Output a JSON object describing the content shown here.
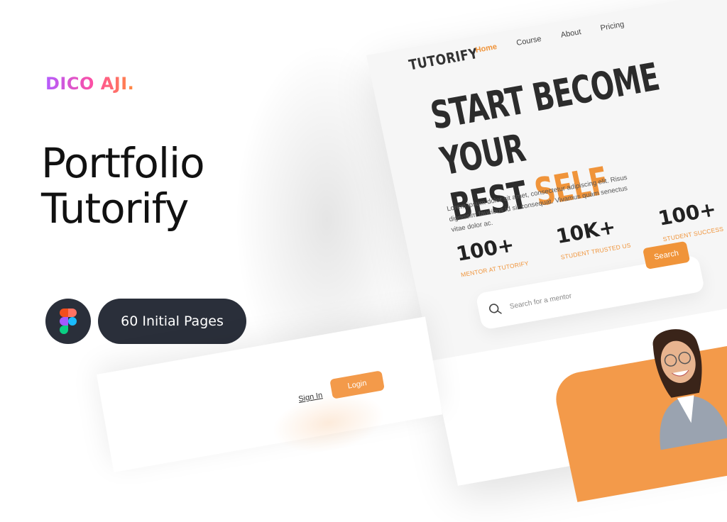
{
  "brand": "DICO AJI.",
  "title_lines": [
    "Portfolio",
    "Tutorify"
  ],
  "badge_icon": "figma-icon",
  "pages_label": "60 Initial Pages",
  "mock": {
    "logo": "TUTORIFY",
    "nav": [
      "Home",
      "Course",
      "About",
      "Pricing"
    ],
    "hero_line1": "START BECOME YOUR",
    "hero_line2a": "BEST ",
    "hero_line2b": "SELF",
    "description": "Lorem ipsum dolor sit amet, consectetur adipiscing elit. Risus dignissim faucibus id sit consequat. Vivamus quam senectus vitae dolor ac.",
    "stats": [
      {
        "num": "100+",
        "label": "MENTOR AT TUTORIFY"
      },
      {
        "num": "10K+",
        "label": "STUDENT TRUSTED US"
      },
      {
        "num": "100+",
        "label": "STUDENT SUCCESS"
      }
    ],
    "search_placeholder": "Search for a mentor",
    "search_button": "Search"
  },
  "mock2": {
    "signin": "Sign In",
    "login": "Login"
  },
  "colors": {
    "accent": "#f0943a",
    "dark_pill": "#2a2f3a"
  }
}
